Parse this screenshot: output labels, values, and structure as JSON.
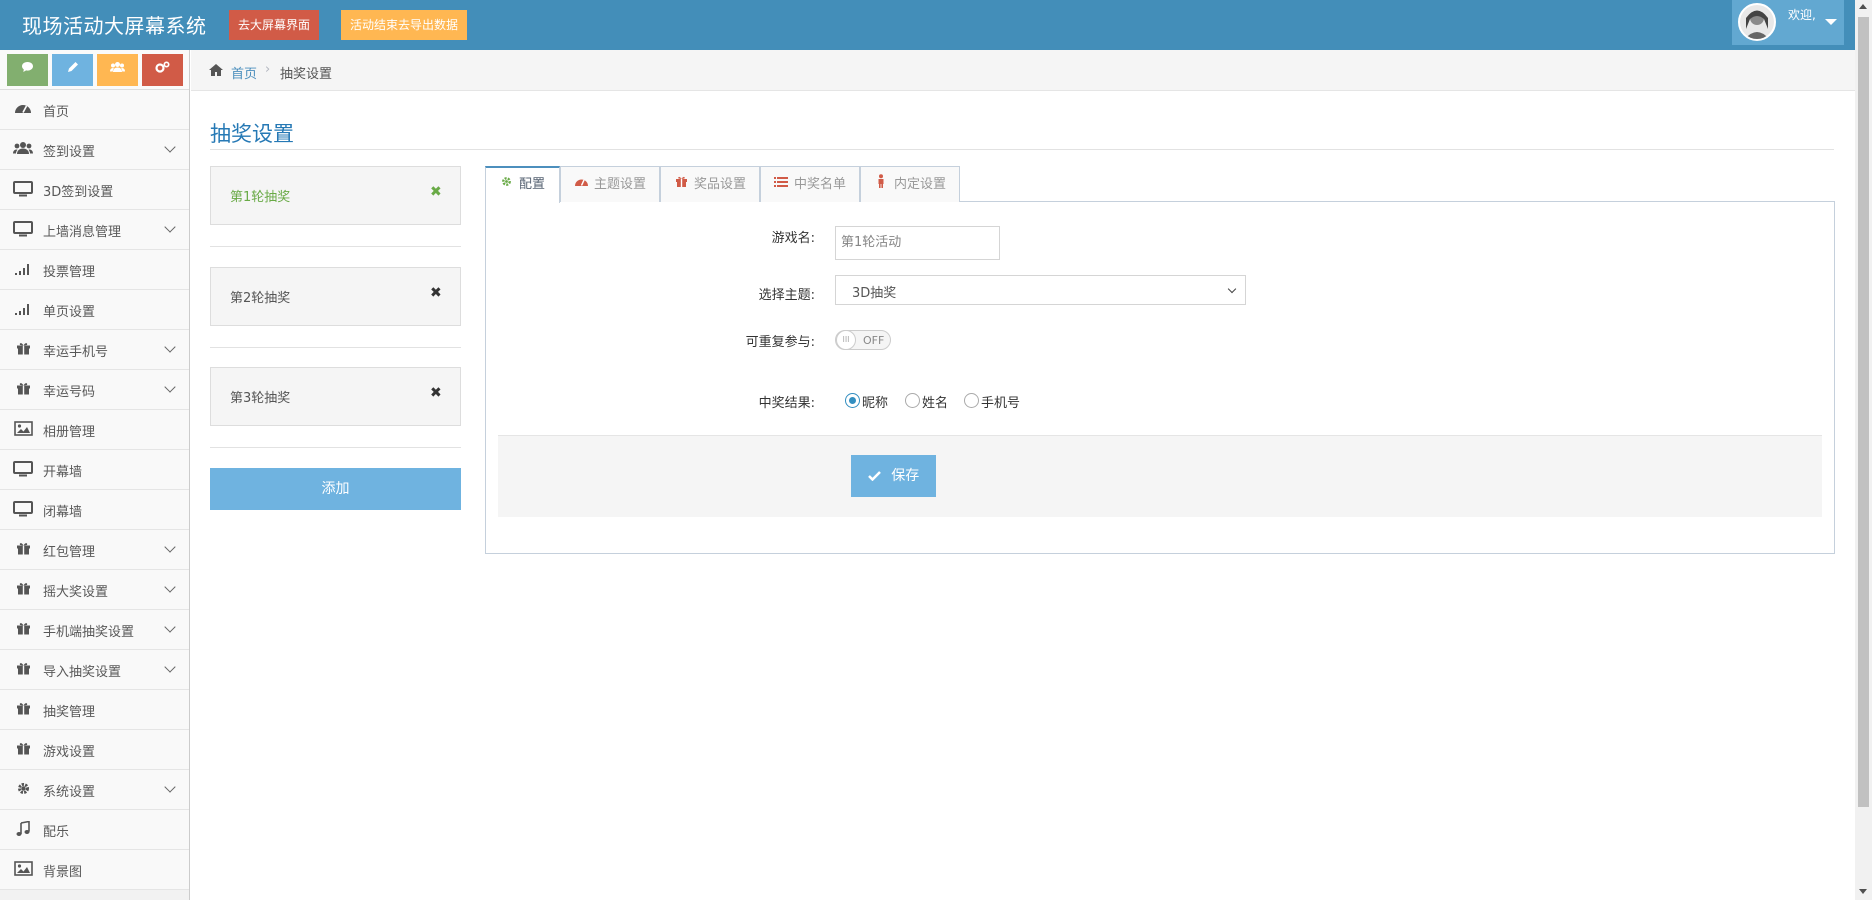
{
  "header": {
    "title": "现场活动大屏幕系统",
    "go_screen_label": "去大屏幕界面",
    "export_label": "活动结束去导出数据",
    "welcome": "欢迎,"
  },
  "shortcuts": [
    {
      "icon": "comment-icon"
    },
    {
      "icon": "pencil-icon"
    },
    {
      "icon": "users-icon"
    },
    {
      "icon": "cogs-icon"
    }
  ],
  "sidebar": {
    "items": [
      {
        "label": "首页",
        "icon": "dashboard-icon",
        "expandable": false
      },
      {
        "label": "签到设置",
        "icon": "users-icon",
        "expandable": true
      },
      {
        "label": "3D签到设置",
        "icon": "desktop-icon",
        "expandable": false
      },
      {
        "label": "上墙消息管理",
        "icon": "desktop-icon",
        "expandable": true
      },
      {
        "label": "投票管理",
        "icon": "signal-icon",
        "expandable": false
      },
      {
        "label": "单页设置",
        "icon": "signal-icon",
        "expandable": false
      },
      {
        "label": "幸运手机号",
        "icon": "gift-icon",
        "expandable": true
      },
      {
        "label": "幸运号码",
        "icon": "gift-icon",
        "expandable": true
      },
      {
        "label": "相册管理",
        "icon": "picture-icon",
        "expandable": false
      },
      {
        "label": "开幕墙",
        "icon": "desktop-icon",
        "expandable": false
      },
      {
        "label": "闭幕墙",
        "icon": "desktop-icon",
        "expandable": false
      },
      {
        "label": "红包管理",
        "icon": "gift-icon",
        "expandable": true
      },
      {
        "label": "摇大奖设置",
        "icon": "gift-icon",
        "expandable": true
      },
      {
        "label": "手机端抽奖设置",
        "icon": "gift-icon",
        "expandable": true
      },
      {
        "label": "导入抽奖设置",
        "icon": "gift-icon",
        "expandable": true
      },
      {
        "label": "抽奖管理",
        "icon": "gift-icon",
        "expandable": false
      },
      {
        "label": "游戏设置",
        "icon": "gift-icon",
        "expandable": false
      },
      {
        "label": "系统设置",
        "icon": "gear-icon",
        "expandable": true
      },
      {
        "label": "配乐",
        "icon": "music-icon",
        "expandable": false
      },
      {
        "label": "背景图",
        "icon": "picture-icon",
        "expandable": false
      }
    ]
  },
  "breadcrumb": {
    "home": "首页",
    "current": "抽奖设置"
  },
  "page": {
    "title": "抽奖设置"
  },
  "rounds": {
    "items": [
      {
        "label": "第1轮抽奖",
        "active": true
      },
      {
        "label": "第2轮抽奖",
        "active": false
      },
      {
        "label": "第3轮抽奖",
        "active": false
      }
    ],
    "add_label": "添加"
  },
  "tabs": [
    {
      "label": "配置",
      "icon": "gear-icon",
      "active": true
    },
    {
      "label": "主题设置",
      "icon": "dashboard-icon",
      "active": false
    },
    {
      "label": "奖品设置",
      "icon": "gift-icon",
      "active": false
    },
    {
      "label": "中奖名单",
      "icon": "list-icon",
      "active": false
    },
    {
      "label": "内定设置",
      "icon": "user-icon",
      "active": false
    }
  ],
  "form": {
    "game_name_label": "游戏名:",
    "game_name_value": "第1轮活动",
    "theme_label": "选择主题:",
    "theme_value": "3D抽奖",
    "repeat_label": "可重复参与:",
    "repeat_toggle": "OFF",
    "result_label": "中奖结果:",
    "result_options": [
      "昵称",
      "姓名",
      "手机号"
    ],
    "result_selected": "昵称",
    "save_label": "保存"
  },
  "colors": {
    "navbar": "#438eb9",
    "danger": "#d15b47",
    "warning": "#ffb752",
    "success": "#82af6f",
    "info": "#6fb3e0",
    "link": "#4c8fbd",
    "active_round": "#69aa46"
  }
}
